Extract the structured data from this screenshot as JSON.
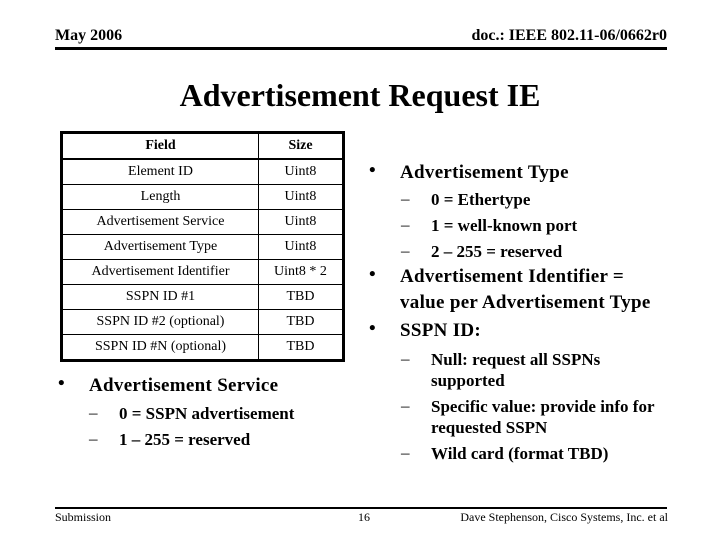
{
  "header": {
    "date": "May 2006",
    "doc_id": "doc.: IEEE 802.11-06/0662r0"
  },
  "title": "Advertisement Request IE",
  "table": {
    "headers": [
      "Field",
      "Size"
    ],
    "rows": [
      [
        "Element ID",
        "Uint8"
      ],
      [
        "Length",
        "Uint8"
      ],
      [
        "Advertisement Service",
        "Uint8"
      ],
      [
        "Advertisement Type",
        "Uint8"
      ],
      [
        "Advertisement Identifier",
        "Uint8 * 2"
      ],
      [
        "SSPN ID #1",
        "TBD"
      ],
      [
        "SSPN ID #2 (optional)",
        "TBD"
      ],
      [
        "SSPN ID #N (optional)",
        "TBD"
      ]
    ]
  },
  "right_bullets": {
    "advertisement_type": {
      "bullet": "•",
      "label": "Advertisement Type",
      "items": [
        "0 = Ethertype",
        "1 = well-known port",
        "2 – 255 = reserved"
      ]
    },
    "advertisement_identifier": {
      "bullet": "•",
      "line1": "Advertisement Identifier =",
      "line2": "value per Advertisement Type"
    },
    "sspn_id": {
      "bullet": "•",
      "label": "SSPN ID:",
      "items": [
        {
          "line1": "Null: request all SSPNs",
          "line2": "supported"
        },
        {
          "line1": "Specific value: provide info for",
          "line2": "requested SSPN"
        },
        {
          "line1": "Wild card (format TBD)"
        }
      ]
    }
  },
  "left_bullets": {
    "advertisement_service": {
      "bullet": "•",
      "label": "Advertisement Service",
      "items": [
        "0 = SSPN advertisement",
        "1 – 255 = reserved"
      ]
    }
  },
  "dash": "–",
  "footer": {
    "left": "Submission",
    "page_number": "16",
    "author": "Dave Stephenson, Cisco Systems, Inc. et al"
  }
}
